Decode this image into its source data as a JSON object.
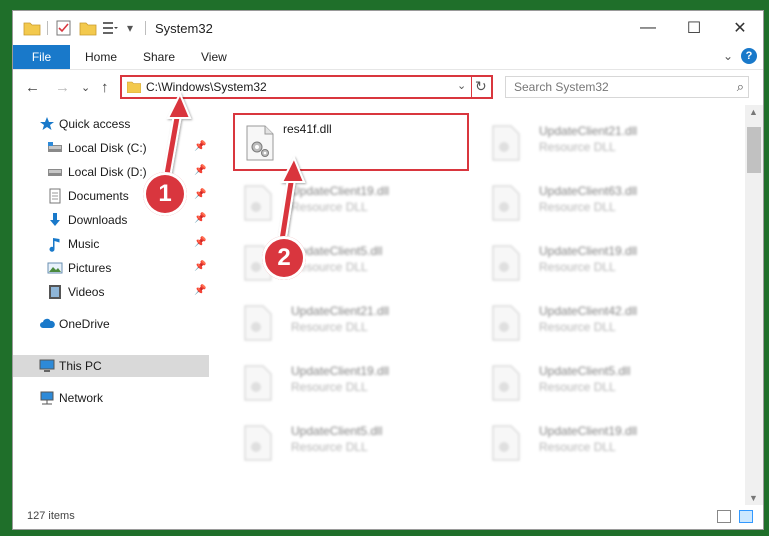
{
  "window": {
    "title": "System32"
  },
  "window_controls": {
    "minimize": "—",
    "maximize": "☐",
    "close": "✕"
  },
  "ribbon": {
    "file": "File",
    "tabs": [
      "Home",
      "Share",
      "View"
    ],
    "expand": "⌄",
    "help": "?"
  },
  "address": {
    "path": "C:\\Windows\\System32",
    "dropdown": "⌄",
    "refresh": "↻"
  },
  "nav_buttons": {
    "back": "←",
    "forward": "→",
    "recent": "⌄",
    "up": "↑"
  },
  "search": {
    "placeholder": "Search System32",
    "icon": "⌕"
  },
  "sidebar": {
    "items": [
      {
        "label": "Quick access",
        "icon": "star-icon"
      },
      {
        "label": "Local Disk (C:)",
        "icon": "drive-icon",
        "pinned": "📌"
      },
      {
        "label": "Local Disk (D:)",
        "icon": "drive-icon",
        "pinned": "📌"
      },
      {
        "label": "Documents",
        "icon": "documents-icon",
        "pinned": "📌"
      },
      {
        "label": "Downloads",
        "icon": "download-icon",
        "pinned": "📌"
      },
      {
        "label": "Music",
        "icon": "music-icon",
        "pinned": "📌"
      },
      {
        "label": "Pictures",
        "icon": "pictures-icon",
        "pinned": "📌"
      },
      {
        "label": "Videos",
        "icon": "videos-icon",
        "pinned": "📌"
      },
      {
        "label": "OneDrive",
        "icon": "cloud-icon"
      },
      {
        "label": "This PC",
        "icon": "computer-icon"
      },
      {
        "label": "Network",
        "icon": "network-icon"
      }
    ]
  },
  "files": {
    "highlighted": {
      "name": "res41f.dll",
      "type": ""
    },
    "items": [
      {
        "name": "UpdateClient21.dll",
        "type": "Resource DLL"
      },
      {
        "name": "UpdateClient19.dll",
        "type": "Resource DLL"
      },
      {
        "name": "UpdateClient63.dll",
        "type": "Resource DLL"
      },
      {
        "name": "UpdateClient5.dll",
        "type": "Resource DLL"
      },
      {
        "name": "UpdateClient19.dll",
        "type": "Resource DLL"
      },
      {
        "name": "UpdateClient21.dll",
        "type": "Resource DLL"
      },
      {
        "name": "UpdateClient42.dll",
        "type": "Resource DLL"
      },
      {
        "name": "UpdateClient19.dll",
        "type": "Resource DLL"
      },
      {
        "name": "UpdateClient5.dll",
        "type": "Resource DLL"
      },
      {
        "name": "UpdateClient5.dll",
        "type": "Resource DLL"
      },
      {
        "name": "UpdateClient19.dll",
        "type": "Resource DLL"
      }
    ]
  },
  "status": {
    "count": "127 items"
  },
  "annotations": {
    "step1": "1",
    "step2": "2"
  },
  "colors": {
    "accent": "#1979ca",
    "highlight": "#d9363e",
    "background": "#1f6f2a"
  }
}
